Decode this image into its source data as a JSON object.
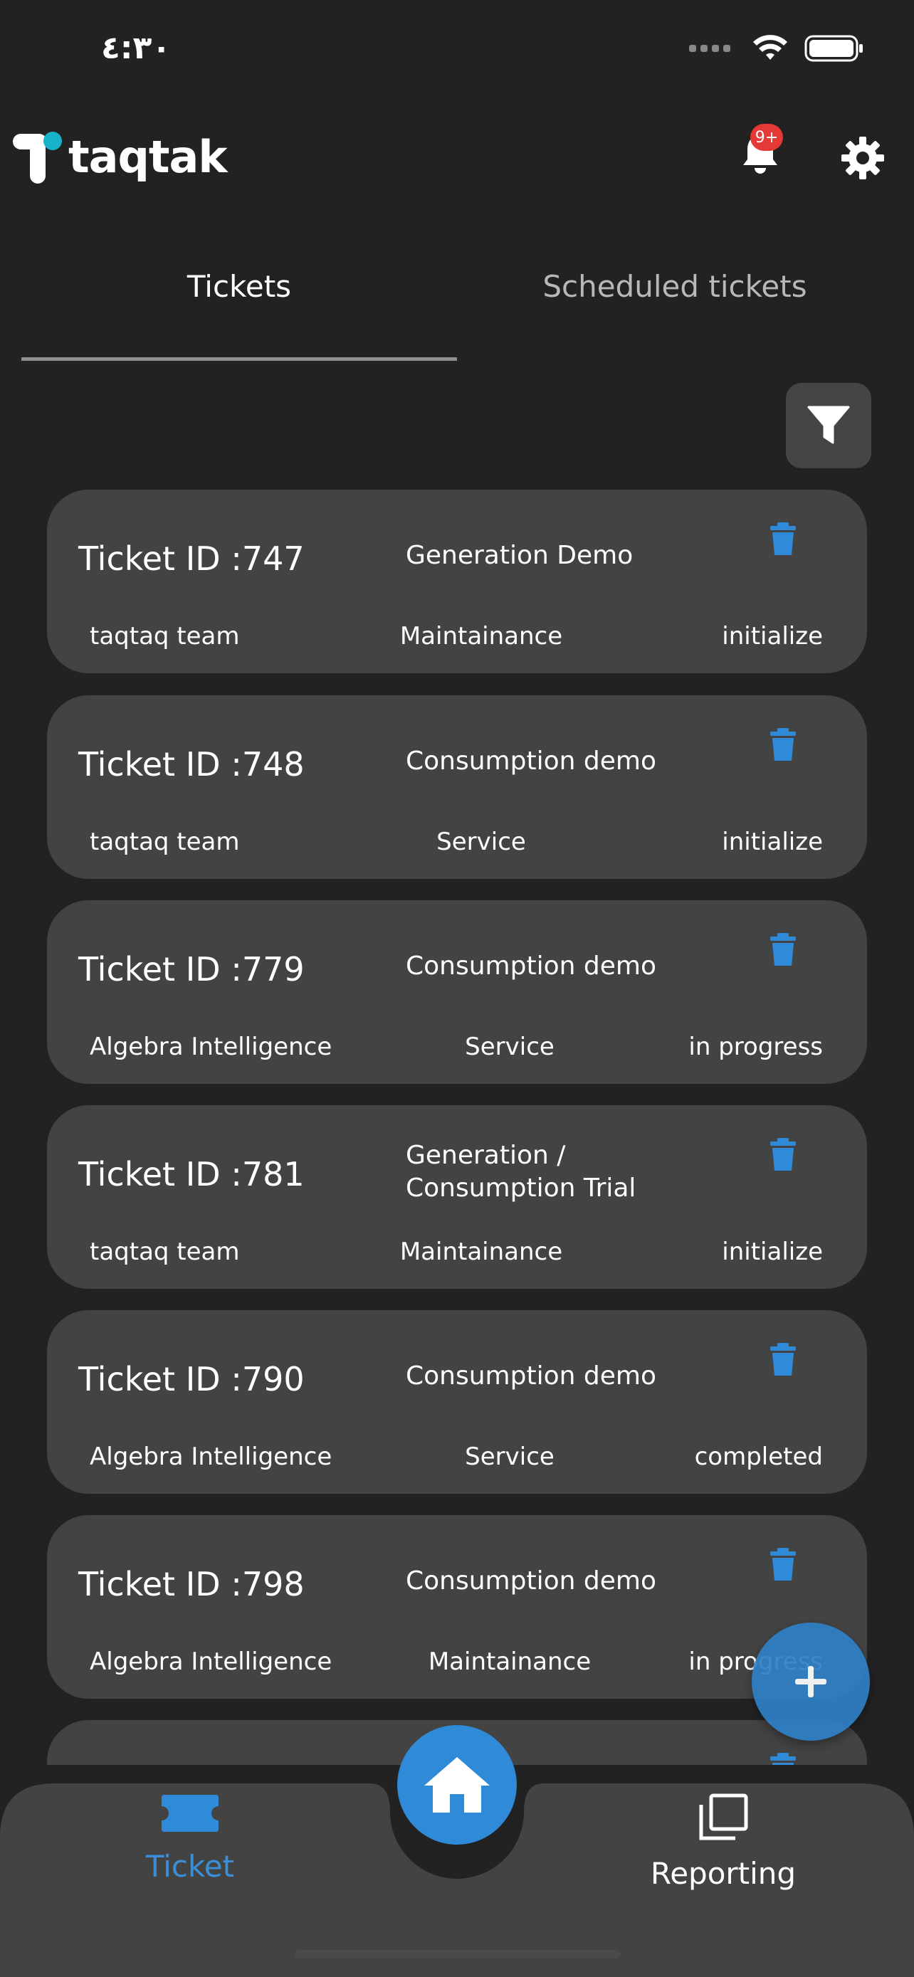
{
  "status_bar": {
    "time": "٤:٣٠"
  },
  "header": {
    "logo_text": "taqtak",
    "notification_badge": "9+",
    "accent_color": "#2f8ad8",
    "badge_color": "#e53935"
  },
  "tabs": [
    {
      "label": "Tickets",
      "active": true
    },
    {
      "label": "Scheduled tickets",
      "active": false
    }
  ],
  "tickets": [
    {
      "id_label": "Ticket ID :747",
      "title": "Generation Demo",
      "team": "taqtaq team",
      "type": "Maintainance",
      "status": "initialize"
    },
    {
      "id_label": "Ticket ID :748",
      "title": "Consumption demo",
      "team": "taqtaq team",
      "type": "Service",
      "status": "initialize"
    },
    {
      "id_label": "Ticket ID :779",
      "title": "Consumption demo",
      "team": "Algebra Intelligence",
      "type": "Service",
      "status": "in progress"
    },
    {
      "id_label": "Ticket ID :781",
      "title": "Generation / Consumption Trial",
      "team": "taqtaq team",
      "type": "Maintainance",
      "status": "initialize"
    },
    {
      "id_label": "Ticket ID :790",
      "title": "Consumption demo",
      "team": "Algebra Intelligence",
      "type": "Service",
      "status": "completed"
    },
    {
      "id_label": "Ticket ID :798",
      "title": "Consumption demo",
      "team": "Algebra Intelligence",
      "type": "Maintainance",
      "status": "in progress"
    }
  ],
  "fab": {
    "icon": "plus-icon"
  },
  "bottom_nav": {
    "ticket_label": "Ticket",
    "reporting_label": "Reporting",
    "home_icon": "home-icon"
  }
}
